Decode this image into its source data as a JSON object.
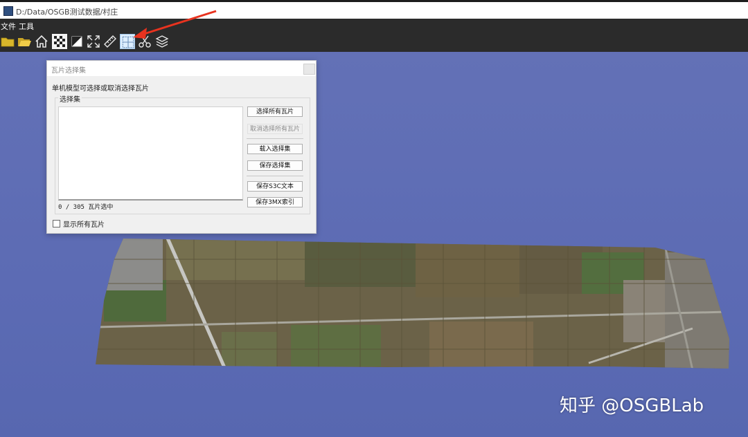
{
  "window": {
    "title": "D:/Data/OSGB测试数据/村庄"
  },
  "menubar": {
    "items": [
      "文件",
      "工具"
    ]
  },
  "toolbar": {
    "icons": [
      "folder-icon",
      "open-folder-icon",
      "home-icon",
      "checker-icon",
      "half-contrast-icon",
      "fullscreen-icon",
      "ruler-icon",
      "tile-select-icon",
      "scissors-icon",
      "layers-icon"
    ],
    "active": "tile-select-icon"
  },
  "dialog": {
    "title": "瓦片选择集",
    "description": "单机模型可选择或取消选择瓦片",
    "group_label": "选择集",
    "count_text": "0 / 305 瓦片选中",
    "buttons": {
      "select_all": "选择所有瓦片",
      "deselect_all": "取消选择所有瓦片",
      "load": "载入选择集",
      "save": "保存选择集",
      "save_s3c": "保存S3C文本",
      "save_3mx": "保存3MX索引"
    },
    "show_all_label": "显示所有瓦片"
  },
  "watermark": "知乎 @OSGBLab",
  "colors": {
    "viewport": "#5f6db5",
    "toolbar": "#2b2b2b",
    "annotation_arrow": "#e8331f"
  }
}
